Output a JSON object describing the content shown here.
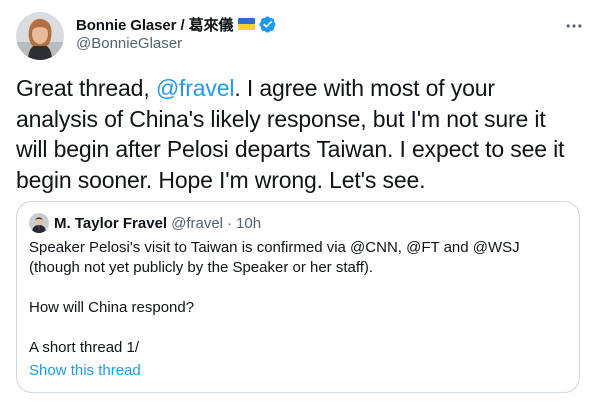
{
  "tweet": {
    "author": {
      "display_name": "Bonnie Glaser / 葛來儀",
      "handle": "@BonnieGlaser",
      "flag_colors": [
        "#2b6cd8",
        "#f7d229"
      ],
      "verified": true
    },
    "body": {
      "before_mention": "Great thread, ",
      "mention": "@fravel",
      "after_mention": ". I agree with most of your analysis of China's likely response, but I'm not sure it will begin after Pelosi departs Taiwan. I expect to see it begin sooner. Hope I'm wrong. Let's see."
    },
    "quote": {
      "display_name": "M. Taylor Fravel",
      "handle": "@fravel",
      "separator": "·",
      "time": "10h",
      "lines": [
        "Speaker Pelosi's visit to Taiwan is confirmed via @CNN, @FT and @WSJ (though not yet publicly by the Speaker or her staff).",
        "",
        "How will China respond?",
        "",
        "A short thread 1/"
      ],
      "show_thread": "Show this thread"
    }
  },
  "colors": {
    "link": "#1d9bf0",
    "text": "#0f1419",
    "secondary": "#536471",
    "border": "#cfd9de",
    "verified": "#1d9bf0"
  }
}
